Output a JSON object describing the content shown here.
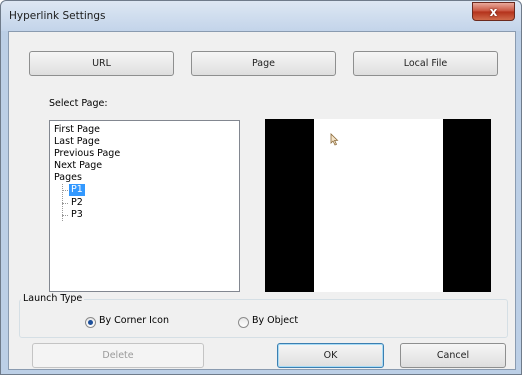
{
  "window": {
    "title": "Hyperlink Settings",
    "close_glyph": "x"
  },
  "top_buttons": {
    "url": "URL",
    "page": "Page",
    "local_file": "Local File"
  },
  "select_page_label": "Select Page:",
  "tree": {
    "items": [
      "First Page",
      "Last Page",
      "Previous Page",
      "Next Page",
      "Pages"
    ],
    "pages": [
      "P1",
      "P2",
      "P3"
    ],
    "selected": "P1"
  },
  "launch_type": {
    "title": "Launch Type",
    "options": [
      "By Corner Icon",
      "By Object"
    ],
    "selected": "By Corner Icon"
  },
  "buttons": {
    "delete": "Delete",
    "ok": "OK",
    "cancel": "Cancel"
  },
  "colors": {
    "selection": "#3399ff",
    "preview_bg": "#000000",
    "page": "#ffffff"
  }
}
